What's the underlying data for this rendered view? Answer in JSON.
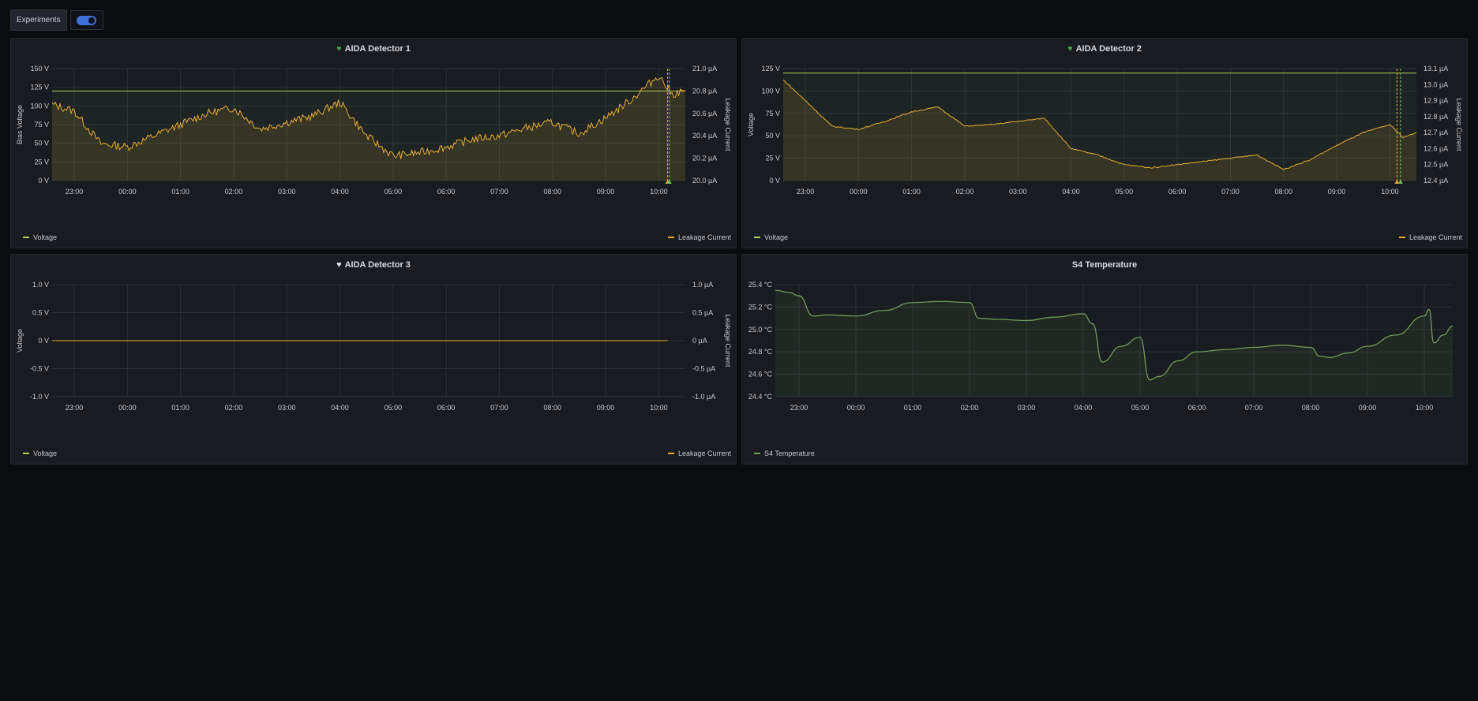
{
  "toolbar": {
    "variable_label": "Experiments",
    "toggle_on": true
  },
  "colors": {
    "voltage": "#b5d05a",
    "leakage": "#e5ac32",
    "temperature": "#6f9a5a",
    "threshold": "#73bf69",
    "accent": "#3d71d9"
  },
  "x_ticks": [
    "23:00",
    "00:00",
    "01:00",
    "02:00",
    "03:00",
    "04:00",
    "05:00",
    "06:00",
    "07:00",
    "08:00",
    "09:00",
    "10:00"
  ],
  "panels": [
    {
      "title": "AIDA Detector 1",
      "status_icon": "green-heart-icon",
      "left_axis_label": "Bias Voltage",
      "right_axis_label": "Leakage Current",
      "left_ticks": [
        "150 V",
        "125 V",
        "100 V",
        "75 V",
        "50 V",
        "25 V",
        "0 V"
      ],
      "right_ticks": [
        "21.0 µA",
        "20.8 µA",
        "20.6 µA",
        "20.4 µA",
        "20.2 µA",
        "20.0 µA"
      ],
      "legend_left": "Voltage",
      "legend_right": "Leakage Current"
    },
    {
      "title": "AIDA Detector 2",
      "status_icon": "green-heart-icon",
      "left_axis_label": "Voltage",
      "right_axis_label": "Leakage Current",
      "left_ticks": [
        "125 V",
        "100 V",
        "75 V",
        "50 V",
        "25 V",
        "0 V"
      ],
      "right_ticks": [
        "13.1 µA",
        "13.0 µA",
        "12.9 µA",
        "12.8 µA",
        "12.7 µA",
        "12.6 µA",
        "12.5 µA",
        "12.4 µA"
      ],
      "legend_left": "Voltage",
      "legend_right": "Leakage Current"
    },
    {
      "title": "AIDA Detector 3",
      "status_icon": "white-heart-icon",
      "left_axis_label": "Voltage",
      "right_axis_label": "Leakage Current",
      "left_ticks": [
        "1.0 V",
        "0.5 V",
        "0 V",
        "-0.5 V",
        "-1.0 V"
      ],
      "right_ticks": [
        "1.0 µA",
        "0.5 µA",
        "0 µA",
        "-0.5 µA",
        "-1.0 µA"
      ],
      "legend_left": "Voltage",
      "legend_right": "Leakage Current"
    },
    {
      "title": "S4 Temperature",
      "left_ticks": [
        "25.4 °C",
        "25.2 °C",
        "25.0 °C",
        "24.8 °C",
        "24.6 °C",
        "24.4 °C"
      ],
      "legend_left": "S4 Temperature"
    }
  ],
  "chart_data": [
    {
      "type": "line",
      "title": "AIDA Detector 1",
      "ylabel": "Bias Voltage",
      "y2label": "Leakage Current",
      "ylim": [
        0,
        150
      ],
      "y2lim": [
        20.0,
        21.0
      ],
      "x": [
        "22:35",
        "23:00",
        "23:30",
        "00:00",
        "00:30",
        "01:00",
        "01:30",
        "02:00",
        "02:30",
        "03:00",
        "03:30",
        "04:00",
        "04:30",
        "05:00",
        "05:30",
        "06:00",
        "06:30",
        "07:00",
        "07:30",
        "08:00",
        "08:30",
        "09:00",
        "09:30",
        "10:00",
        "10:15",
        "10:30"
      ],
      "series": [
        {
          "name": "Voltage",
          "values": [
            120,
            120,
            120,
            120,
            120,
            120,
            120,
            120,
            120,
            120,
            120,
            120,
            120,
            120,
            120,
            120,
            120,
            120,
            120,
            120,
            120,
            120,
            120,
            120,
            120,
            120
          ]
        },
        {
          "name": "Leakage Current",
          "axis": "right",
          "values": [
            20.68,
            20.62,
            20.33,
            20.3,
            20.4,
            20.5,
            20.6,
            20.65,
            20.46,
            20.52,
            20.58,
            20.7,
            20.4,
            20.22,
            20.25,
            20.3,
            20.37,
            20.4,
            20.47,
            20.52,
            20.42,
            20.56,
            20.73,
            20.94,
            20.77,
            20.8
          ]
        }
      ],
      "annotations": [
        "10:10",
        "10:12"
      ],
      "grid": true,
      "legend": "bottom"
    },
    {
      "type": "line",
      "title": "AIDA Detector 2",
      "ylabel": "Voltage",
      "y2label": "Leakage Current",
      "ylim": [
        0,
        125
      ],
      "y2lim": [
        12.4,
        13.1
      ],
      "x": [
        "22:35",
        "23:00",
        "23:30",
        "00:00",
        "00:30",
        "01:00",
        "01:30",
        "02:00",
        "02:30",
        "03:00",
        "03:30",
        "04:00",
        "04:30",
        "05:00",
        "05:30",
        "06:00",
        "06:30",
        "07:00",
        "07:30",
        "08:00",
        "08:30",
        "09:00",
        "09:30",
        "10:00",
        "10:15",
        "10:30"
      ],
      "series": [
        {
          "name": "Voltage",
          "values": [
            120,
            120,
            120,
            120,
            120,
            120,
            120,
            120,
            120,
            120,
            120,
            120,
            120,
            120,
            120,
            120,
            120,
            120,
            120,
            120,
            120,
            120,
            120,
            120,
            120,
            120
          ]
        },
        {
          "name": "Leakage Current",
          "axis": "right",
          "values": [
            13.03,
            12.9,
            12.74,
            12.72,
            12.77,
            12.83,
            12.86,
            12.74,
            12.75,
            12.77,
            12.79,
            12.6,
            12.56,
            12.5,
            12.48,
            12.5,
            12.52,
            12.54,
            12.56,
            12.47,
            12.53,
            12.62,
            12.7,
            12.75,
            12.67,
            12.7
          ]
        }
      ],
      "annotations": [
        "10:08",
        "10:12"
      ],
      "grid": true,
      "legend": "bottom"
    },
    {
      "type": "line",
      "title": "AIDA Detector 3",
      "ylabel": "Voltage",
      "y2label": "Leakage Current",
      "ylim": [
        -1.0,
        1.0
      ],
      "y2lim": [
        -1.0,
        1.0
      ],
      "x": [
        "22:35",
        "23:00",
        "00:00",
        "01:00",
        "02:00",
        "03:00",
        "04:00",
        "05:00",
        "06:00",
        "07:00",
        "08:00",
        "09:00",
        "10:00",
        "10:10"
      ],
      "series": [
        {
          "name": "Voltage",
          "values": [
            0,
            0,
            0,
            0,
            0,
            0,
            0,
            0,
            0,
            0,
            0,
            0,
            0,
            0
          ]
        },
        {
          "name": "Leakage Current",
          "axis": "right",
          "values": [
            0,
            0,
            0,
            0,
            0,
            0,
            0,
            0,
            0,
            0,
            0,
            0,
            0,
            0
          ]
        }
      ],
      "grid": true,
      "legend": "bottom"
    },
    {
      "type": "area",
      "title": "S4 Temperature",
      "ylim": [
        24.4,
        25.4
      ],
      "x": [
        "22:35",
        "22:50",
        "23:00",
        "23:15",
        "23:30",
        "00:00",
        "00:30",
        "01:00",
        "01:30",
        "02:00",
        "02:10",
        "02:30",
        "03:00",
        "03:30",
        "04:00",
        "04:10",
        "04:20",
        "04:40",
        "05:00",
        "05:10",
        "05:20",
        "05:40",
        "06:00",
        "06:30",
        "07:00",
        "07:30",
        "08:00",
        "08:10",
        "08:20",
        "08:40",
        "09:00",
        "09:30",
        "10:00",
        "10:05",
        "10:10",
        "10:20",
        "10:30"
      ],
      "series": [
        {
          "name": "S4 Temperature",
          "values": [
            25.35,
            25.33,
            25.3,
            25.12,
            25.13,
            25.12,
            25.17,
            25.24,
            25.25,
            25.24,
            25.1,
            25.09,
            25.08,
            25.11,
            25.14,
            25.05,
            24.71,
            24.85,
            24.93,
            24.55,
            24.58,
            24.72,
            24.8,
            24.82,
            24.84,
            24.86,
            24.84,
            24.76,
            24.75,
            24.79,
            24.85,
            24.95,
            25.12,
            25.18,
            24.88,
            24.95,
            25.03
          ]
        }
      ],
      "grid": true,
      "legend": "bottom"
    }
  ]
}
